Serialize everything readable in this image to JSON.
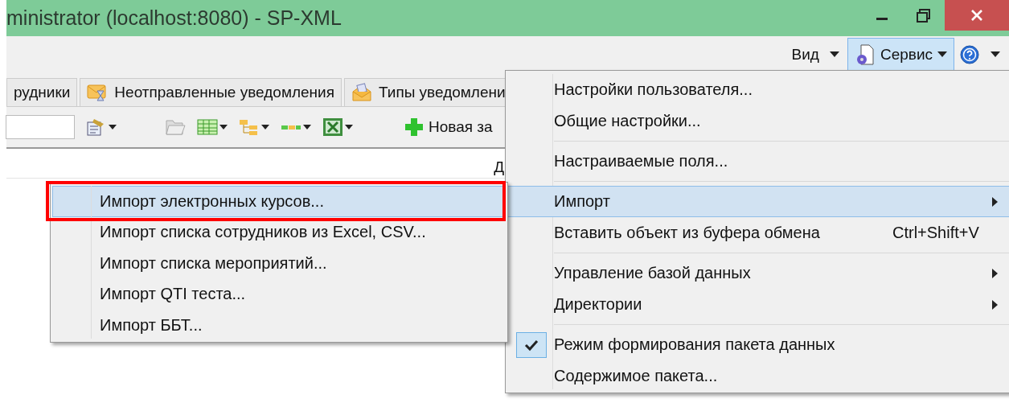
{
  "window": {
    "title": "ministrator (localhost:8080) - SP-XML"
  },
  "menu_bar": {
    "items": [
      {
        "label": "Вид",
        "kind": "text",
        "selected": false
      },
      {
        "label": "Сервис",
        "kind": "service",
        "selected": true
      },
      {
        "kind": "help",
        "selected": false
      }
    ]
  },
  "tabs": [
    {
      "label": "рудники"
    },
    {
      "label": "Неотправленные уведомления"
    },
    {
      "label": "Типы уведомлени"
    }
  ],
  "toolbar": {
    "new_button": "Новая за"
  },
  "table": {
    "columns": [
      "Д"
    ]
  },
  "main_menu": {
    "items": [
      {
        "kind": "item",
        "label": "Настройки пользователя...",
        "selected": false,
        "checked": false,
        "submenu": false
      },
      {
        "kind": "item",
        "label": "Общие настройки...",
        "selected": false,
        "checked": false,
        "submenu": false
      },
      {
        "kind": "separator"
      },
      {
        "kind": "item",
        "label": "Настраиваемые поля...",
        "selected": false,
        "checked": false,
        "submenu": false
      },
      {
        "kind": "separator"
      },
      {
        "kind": "item",
        "label": "Импорт",
        "selected": true,
        "checked": false,
        "submenu": true
      },
      {
        "kind": "item",
        "label": "Вставить объект из буфера обмена",
        "shortcut": "Ctrl+Shift+V",
        "selected": false,
        "checked": false,
        "submenu": false
      },
      {
        "kind": "separator"
      },
      {
        "kind": "item",
        "label": "Управление базой данных",
        "selected": false,
        "checked": false,
        "submenu": true
      },
      {
        "kind": "item",
        "label": "Директории",
        "selected": false,
        "checked": false,
        "submenu": true
      },
      {
        "kind": "separator"
      },
      {
        "kind": "item",
        "label": "Режим формирования пакета данных",
        "selected": false,
        "checked": true,
        "submenu": false
      },
      {
        "kind": "item",
        "label": "Содержимое пакета...",
        "selected": false,
        "checked": false,
        "submenu": false
      }
    ]
  },
  "import_submenu": {
    "items": [
      {
        "label": "Импорт электронных курсов...",
        "selected": true,
        "outlined": true
      },
      {
        "label": "Импорт списка сотрудников из Excel, CSV...",
        "selected": false,
        "outlined": false
      },
      {
        "label": "Импорт списка мероприятий...",
        "selected": false,
        "outlined": false
      },
      {
        "label": "Импорт QTI теста...",
        "selected": false,
        "outlined": false
      },
      {
        "label": "Импорт ББТ...",
        "selected": false,
        "outlined": false
      }
    ]
  }
}
